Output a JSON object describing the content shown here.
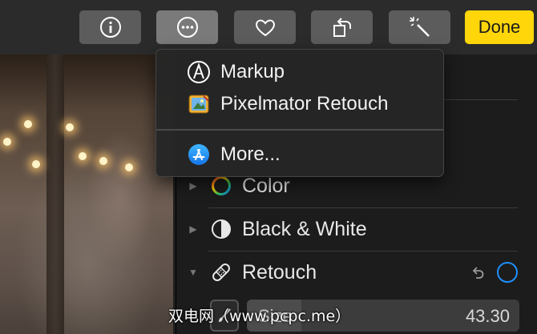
{
  "toolbar": {
    "buttons": [
      "info",
      "more",
      "favorite",
      "rotate",
      "enhance"
    ],
    "done_label": "Done",
    "accent": "#ffd60a"
  },
  "menu": {
    "items": [
      {
        "label": "Markup",
        "icon": "markup-icon"
      },
      {
        "label": "Pixelmator Retouch",
        "icon": "pixelmator-icon"
      },
      {
        "label": "More...",
        "icon": "app-store-icon"
      }
    ]
  },
  "panel": {
    "sections": [
      {
        "label": "Color",
        "icon": "color-wheel-icon"
      },
      {
        "label": "Black & White",
        "icon": "black-white-icon"
      },
      {
        "label": "Retouch",
        "icon": "bandage-icon"
      }
    ],
    "slider": {
      "label": "Size",
      "value": "43.30",
      "fraction": 0.2
    },
    "toggle_color": "#1e90ff"
  },
  "watermark": "双电网（www.pcpc.me）"
}
